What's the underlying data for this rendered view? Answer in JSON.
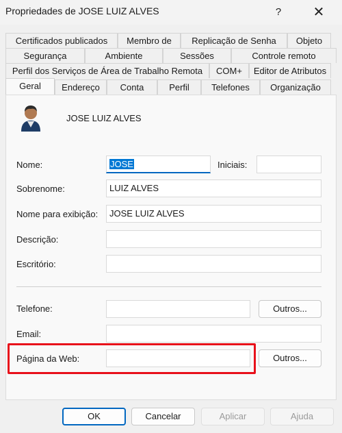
{
  "window": {
    "title": "Propriedades de JOSE LUIZ ALVES",
    "help_glyph": "?",
    "close_glyph": "✕"
  },
  "tabs": {
    "row1": [
      "Certificados publicados",
      "Membro de",
      "Replicação de Senha",
      "Objeto"
    ],
    "row2": [
      "Segurança",
      "Ambiente",
      "Sessões",
      "Controle remoto"
    ],
    "row3": [
      "Perfil dos Serviços de Área de Trabalho Remota",
      "COM+",
      "Editor de Atributos"
    ],
    "row4": [
      "Geral",
      "Endereço",
      "Conta",
      "Perfil",
      "Telefones",
      "Organização"
    ],
    "active": "Geral"
  },
  "general": {
    "display_name": "JOSE LUIZ ALVES",
    "first_name_label": "Nome:",
    "first_name_value": "JOSE",
    "initials_label": "Iniciais:",
    "initials_value": "",
    "last_name_label": "Sobrenome:",
    "last_name_value": "LUIZ ALVES",
    "display_label": "Nome para exibição:",
    "display_value": "JOSE LUIZ ALVES",
    "description_label": "Descrição:",
    "description_value": "",
    "office_label": "Escritório:",
    "office_value": "",
    "phone_label": "Telefone:",
    "phone_value": "",
    "phone_other_button": "Outros...",
    "email_label": "Email:",
    "email_value": "",
    "web_label": "Página da Web:",
    "web_value": "",
    "web_other_button": "Outros..."
  },
  "footer": {
    "ok": "OK",
    "cancel": "Cancelar",
    "apply": "Aplicar",
    "help": "Ajuda"
  },
  "colors": {
    "accent": "#0067c0",
    "highlight_box": "#e8101a"
  }
}
